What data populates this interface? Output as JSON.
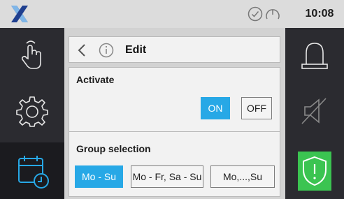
{
  "status_bar": {
    "time": "10:08",
    "logo_icon": "x-logo-icon",
    "status_icons": [
      "check-circle-icon",
      "gauge-icon"
    ]
  },
  "left_nav": {
    "items": [
      {
        "name": "touch",
        "icon": "hand-pointer-icon",
        "active": false
      },
      {
        "name": "settings",
        "icon": "gear-icon",
        "active": false
      },
      {
        "name": "schedule",
        "icon": "calendar-clock-icon",
        "active": true
      }
    ]
  },
  "right_nav": {
    "items": [
      {
        "name": "alarm",
        "icon": "beacon-icon"
      },
      {
        "name": "mute",
        "icon": "speaker-muted-icon"
      },
      {
        "name": "security",
        "icon": "shield-alert-icon",
        "color": "#3bc451"
      }
    ]
  },
  "edit_header": {
    "title": "Edit"
  },
  "activate": {
    "label": "Activate",
    "on_label": "ON",
    "off_label": "OFF",
    "selected": "ON"
  },
  "group_selection": {
    "label": "Group selection",
    "options": [
      "Mo - Su",
      "Mo - Fr, Sa - Su",
      "Mo,...,Su"
    ],
    "selected": "Mo - Su"
  },
  "colors": {
    "accent": "#27a8e6",
    "highlight": "#3bc451",
    "sidebar_bg": "#2b2b30",
    "topbar_bg": "#dcdcdc"
  }
}
